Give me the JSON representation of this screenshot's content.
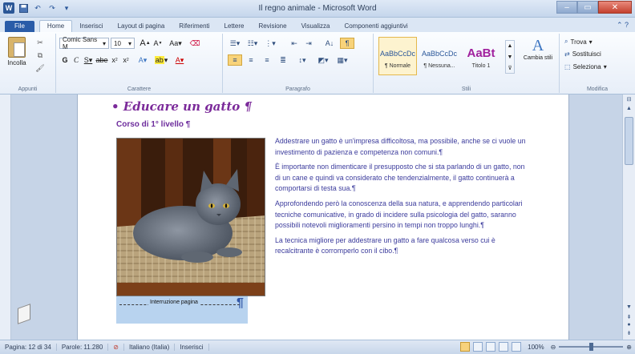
{
  "window": {
    "title": "Il regno animale - Microsoft Word"
  },
  "quick_access": {
    "app_icon": "W",
    "save_icon": "save-icon",
    "undo_icon": "undo-icon",
    "redo_icon": "redo-icon"
  },
  "tabs": [
    {
      "label": "File"
    },
    {
      "label": "Home"
    },
    {
      "label": "Inserisci"
    },
    {
      "label": "Layout di pagina"
    },
    {
      "label": "Riferimenti"
    },
    {
      "label": "Lettere"
    },
    {
      "label": "Revisione"
    },
    {
      "label": "Visualizza"
    },
    {
      "label": "Componenti aggiuntivi"
    }
  ],
  "ribbon": {
    "clipboard": {
      "paste_label": "Incolla",
      "group_label": "Appunti"
    },
    "font": {
      "font_name": "Comic Sans M",
      "font_size": "10",
      "group_label": "Carattere"
    },
    "paragraph": {
      "group_label": "Paragrafo"
    },
    "styles": {
      "items": [
        {
          "sample": "AaBbCcDc",
          "name": "¶ Normale"
        },
        {
          "sample": "AaBbCcDc",
          "name": "¶ Nessuna..."
        },
        {
          "sample": "AaBt",
          "name": "Titolo 1"
        }
      ],
      "change_label": "Cambia stili",
      "group_label": "Stili"
    },
    "editing": {
      "find_label": "Trova",
      "replace_label": "Sostituisci",
      "select_label": "Seleziona",
      "group_label": "Modifica"
    }
  },
  "document": {
    "heading": "• Educare un gatto ¶",
    "subheading": "Corso di 1° livello ¶",
    "paragraphs": [
      "Addestrare un gatto è un'impresa difficoltosa, ma possibile, anche se ci vuole un investimento di pazienza e competenza non comuni.¶",
      "È importante non dimenticare il presupposto che si sta parlando di un gatto, non di un cane e quindi va considerato che tendenzialmente, il gatto continuerà a comportarsi di testa sua.¶",
      "Approfondendo però la conoscenza della sua natura, e apprendendo particolari tecniche comunicative, in grado di incidere sulla psicologia del gatto, saranno possibili notevoli miglioramenti persino in tempi non troppo lunghi.¶",
      "La tecnica migliore per addestrare un gatto a fare qualcosa verso cui è recalcitrante è corromperlo con il cibo.¶"
    ],
    "page_break_label": "Interruzione pagina",
    "page_break_mark": "¶"
  },
  "status_bar": {
    "page": "Pagina: 12 di 34",
    "words": "Parole: 11.280",
    "language": "Italiano (Italia)",
    "mode": "Inserisci",
    "zoom": "100%",
    "zoom_fraction": 0.5
  },
  "colors": {
    "accent": "#2b579a",
    "heading": "#7b2a9a",
    "body_text": "#3b3b9c",
    "page_break_bg": "#b8d3ef"
  }
}
